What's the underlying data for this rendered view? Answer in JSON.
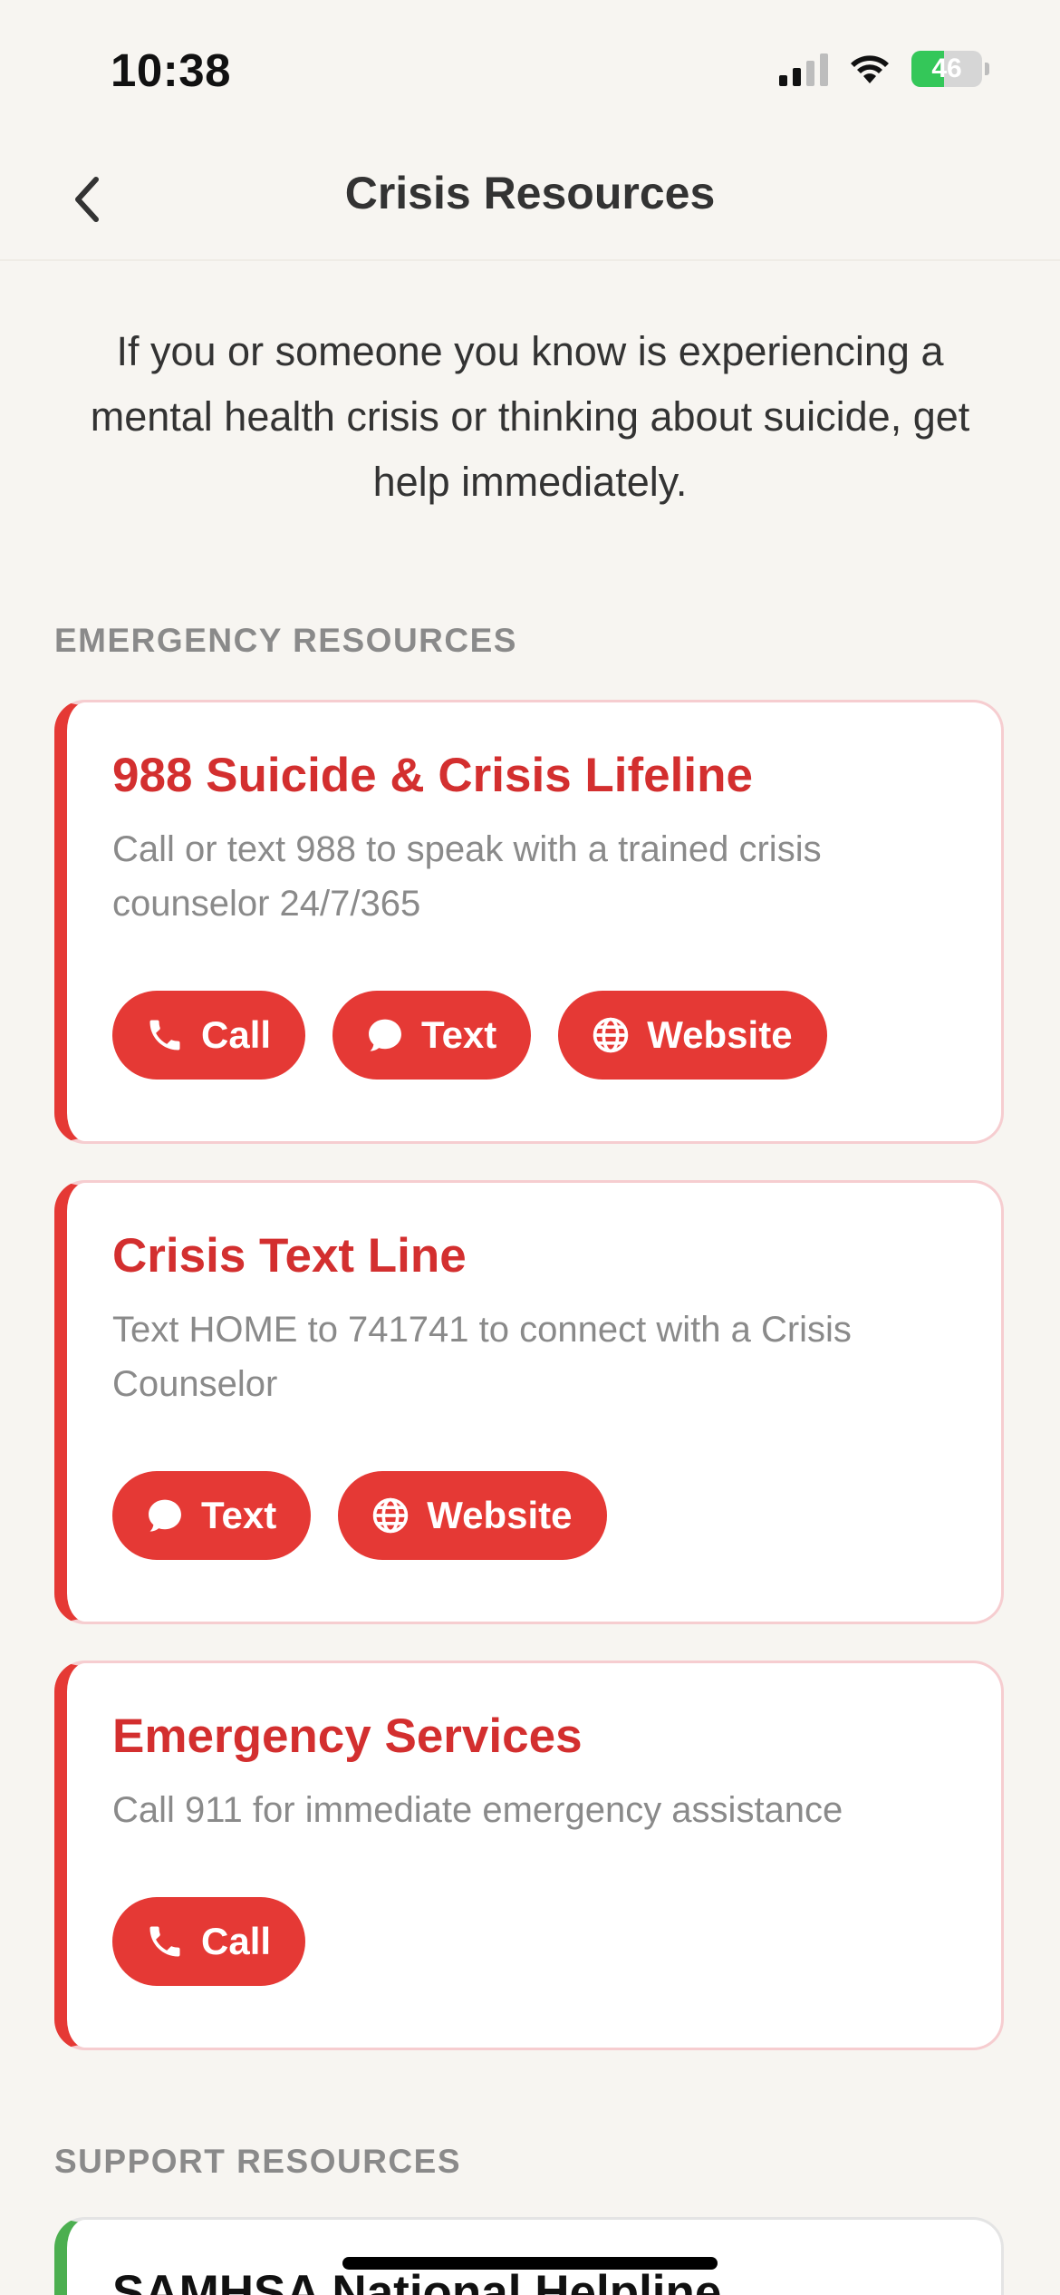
{
  "status_bar": {
    "time": "10:38",
    "battery": "46"
  },
  "nav": {
    "title": "Crisis Resources",
    "back_icon": "chevron-left-icon"
  },
  "intro": "If you or someone you know is experiencing a mental health crisis or thinking about suicide, get help immediately.",
  "sections": {
    "emergency": "EMERGENCY RESOURCES",
    "support": "SUPPORT RESOURCES"
  },
  "emergency_cards": [
    {
      "title": "988 Suicide & Crisis Lifeline",
      "description": "Call or text 988 to speak with a trained crisis counselor 24/7/365",
      "buttons": {
        "call": "Call",
        "text": "Text",
        "website": "Website"
      }
    },
    {
      "title": "Crisis Text Line",
      "description": "Text HOME to 741741 to connect with a Crisis Counselor",
      "buttons": {
        "text": "Text",
        "website": "Website"
      }
    },
    {
      "title": "Emergency Services",
      "description": "Call 911 for immediate emergency assistance",
      "buttons": {
        "call": "Call"
      }
    }
  ],
  "support_cards": [
    {
      "title": "SAMHSA National Helpline"
    }
  ],
  "colors": {
    "accent_red": "#E53935",
    "title_red": "#D32F2F",
    "support_green": "#4CAF50",
    "background": "#F7F5F1"
  }
}
